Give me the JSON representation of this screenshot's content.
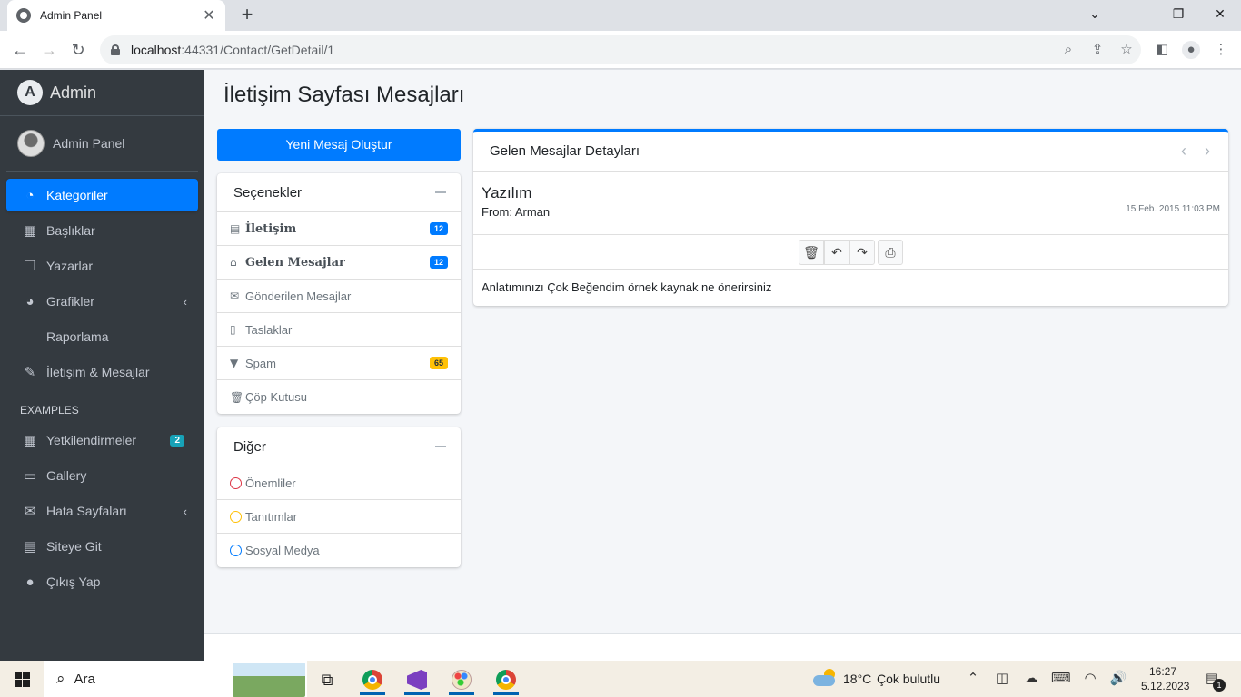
{
  "browser": {
    "tab_title": "Admin Panel",
    "tab_close": "✕",
    "new_tab": "+",
    "url_host": "localhost",
    "url_path": ":44331/Contact/GetDetail/1",
    "window_controls": {
      "minimize": "—",
      "restore": "❐",
      "close": "✕"
    }
  },
  "sidebar": {
    "brand": "Admin",
    "brand_logo": "A",
    "user_name": "Admin Panel",
    "items": [
      {
        "label": "Kategoriler",
        "icon": "dashboard-icon",
        "glyph": "◔",
        "active": true
      },
      {
        "label": "Başlıklar",
        "icon": "grid-icon",
        "glyph": "▦"
      },
      {
        "label": "Yazarlar",
        "icon": "copy-icon",
        "glyph": "❐"
      },
      {
        "label": "Grafikler",
        "icon": "pie-chart-icon",
        "glyph": "◕",
        "arrow": "‹"
      },
      {
        "label": "Raporlama",
        "icon": "",
        "glyph": ""
      },
      {
        "label": "İletişim & Mesajlar",
        "icon": "edit-icon",
        "glyph": "✎"
      }
    ],
    "section_header": "EXAMPLES",
    "examples": [
      {
        "label": "Yetkilendirmeler",
        "icon": "calendar-icon",
        "glyph": "▦",
        "badge": "2"
      },
      {
        "label": "Gallery",
        "icon": "image-icon",
        "glyph": "▭"
      },
      {
        "label": "Hata Sayfaları",
        "icon": "envelope-icon",
        "glyph": "✉",
        "arrow": "‹"
      },
      {
        "label": "Siteye Git",
        "icon": "document-icon",
        "glyph": "▤"
      },
      {
        "label": "Çıkış Yap",
        "icon": "apple-icon",
        "glyph": "●"
      }
    ]
  },
  "main": {
    "title": "İletişim Sayfası Mesajları",
    "new_message_button": "Yeni Mesaj Oluştur",
    "options_card": {
      "title": "Seçenekler",
      "items": [
        {
          "label": "İletişim",
          "glyph": "▤",
          "badge": "12",
          "bold": true
        },
        {
          "label": "Gelen Mesajlar",
          "glyph": "⌂",
          "badge": "12",
          "bold": true
        },
        {
          "label": "Gönderilen Mesajlar",
          "glyph": "✉"
        },
        {
          "label": "Taslaklar",
          "glyph": "▯"
        },
        {
          "label": "Spam",
          "glyph": "▼",
          "badge": "65"
        },
        {
          "label": "Çöp Kutusu",
          "glyph": "🗑"
        }
      ]
    },
    "other_card": {
      "title": "Diğer",
      "items": [
        {
          "label": "Önemliler",
          "color": "#dc3545"
        },
        {
          "label": "Tanıtımlar",
          "color": "#ffc107"
        },
        {
          "label": "Sosyal Medya",
          "color": "#007bff"
        }
      ]
    },
    "detail_card": {
      "title": "Gelen Mesajlar Detayları",
      "subject": "Yazılım",
      "from": "From: Arman",
      "date": "15 Feb. 2015 11:03 PM",
      "body": "Anlatımınızı Çok Beğendim örnek kaynak ne önerirsiniz",
      "prev": "‹",
      "next": "›"
    }
  },
  "taskbar": {
    "search_placeholder": "Ara",
    "weather_temp": "18°C",
    "weather_text": "Çok bulutlu",
    "time": "16:27",
    "date": "5.12.2023",
    "notification_count": "1"
  }
}
